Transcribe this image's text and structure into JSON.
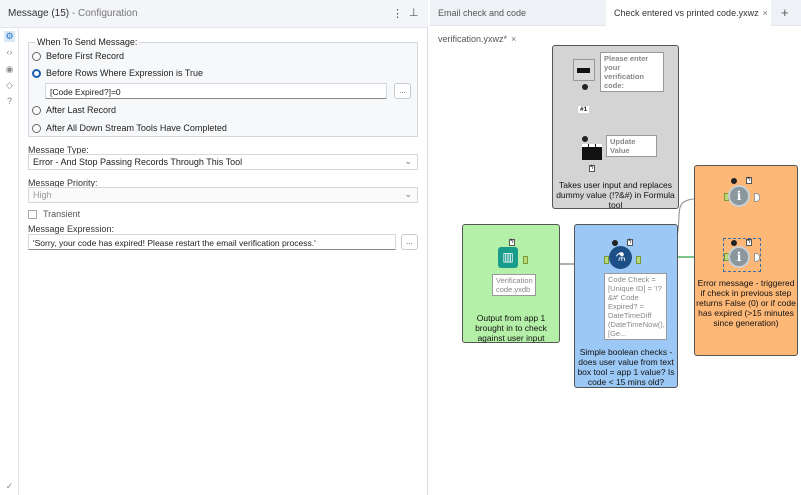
{
  "panel": {
    "title": "Message (15)",
    "subtitle": " - Configuration",
    "menu_icon": "more-vertical-icon",
    "pin_icon": "pin-icon"
  },
  "strip": [
    "gear-icon",
    "code-icon",
    "target-icon",
    "tag-icon",
    "help-icon"
  ],
  "when": {
    "legend": "When To Send Message:",
    "options": [
      "Before First Record",
      "Before Rows Where Expression is True",
      "After Last Record",
      "After All Down Stream Tools Have Completed"
    ],
    "selected": 1,
    "expression": "[Code Expired?]=0",
    "ellipsis": "..."
  },
  "message_type": {
    "label": "Message Type:",
    "value": "Error - And Stop Passing Records Through This Tool"
  },
  "message_priority": {
    "label": "Message Priority:",
    "value": "High"
  },
  "transient": {
    "label": "Transient",
    "checked": false
  },
  "message_expression": {
    "label": "Message Expression:",
    "value": "'Sorry, your code has expired! Please restart the email verification process.'",
    "ellipsis": "..."
  },
  "tabs": [
    {
      "label": "Email check and code verification.yxwz*",
      "active": false
    },
    {
      "label": "Check entered vs printed code.yxwz",
      "active": true
    }
  ],
  "tab_close": "×",
  "tab_add": "+",
  "canvas": {
    "gray": {
      "note1": "Please enter your verification code:",
      "conn_label": "#1",
      "note2": "Update Value",
      "caption": "Takes user input and replaces dummy value (!?&#) in Formula tool",
      "color": "#d4d4d4"
    },
    "green": {
      "note": "Verification code.yxdb",
      "caption": "Output from app 1 brought in to check against user input",
      "color": "#b5f0a8"
    },
    "blue": {
      "note": "Code Check = [Unique ID] = '!?&#' Code Expired? = DateTimeDiff (DateTimeNow(), [Ge...",
      "caption": "Simple boolean checks - does user value from text box tool = app 1 value? Is code < 15 mins old?",
      "color": "#9cc8f5"
    },
    "orange": {
      "caption": "Error message - triggered if check in previous step returns False (0) or if code has expired (>15 minutes since generation)",
      "color": "#fdb878"
    }
  }
}
